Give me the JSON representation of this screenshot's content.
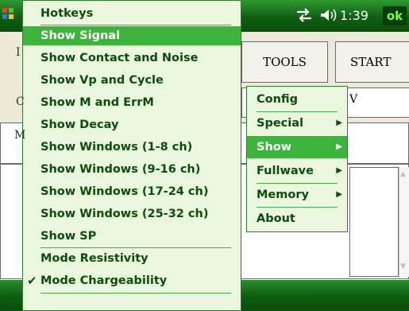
{
  "titlebar": {
    "start_icon": "windows-flag-icon",
    "connectivity_icon": "connectivity-icon",
    "volume_icon": "speaker-icon",
    "time": "1:39",
    "ok_label": "ok"
  },
  "workspace": {
    "tools_label": "TOOLS",
    "start_label": "START",
    "field_fragment": "V",
    "left_fragments": [
      "I",
      "C",
      "M"
    ]
  },
  "menu": {
    "items": [
      {
        "label": "Hotkeys"
      },
      {
        "label": "Show Signal",
        "selected": true
      },
      {
        "label": "Show Contact and Noise"
      },
      {
        "label": "Show Vp and Cycle"
      },
      {
        "label": "Show M and ErrM"
      },
      {
        "label": "Show Decay"
      },
      {
        "label": "Show Windows (1-8 ch)"
      },
      {
        "label": "Show Windows (9-16 ch)"
      },
      {
        "label": "Show Windows (17-24 ch)"
      },
      {
        "label": "Show Windows (25-32 ch)"
      },
      {
        "label": "Show SP"
      },
      {
        "label": "Mode Resistivity"
      },
      {
        "label": "Mode Chargeability",
        "checked": true
      }
    ],
    "check_mark": "✔"
  },
  "submenu": {
    "items": [
      {
        "label": "Config"
      },
      {
        "label": "Special",
        "has_submenu": true
      },
      {
        "label": "Show",
        "has_submenu": true,
        "selected": true
      },
      {
        "label": "Fullwave",
        "has_submenu": true
      },
      {
        "label": "Memory",
        "has_submenu": true
      },
      {
        "label": "About"
      }
    ],
    "arrow_glyph": "▶"
  },
  "colors": {
    "title_green": "#0f5f12",
    "menu_background": "#eaf6de",
    "menu_text": "#0b4d0b",
    "highlight": "#3cb43c",
    "ok_text": "#7dff3a"
  }
}
